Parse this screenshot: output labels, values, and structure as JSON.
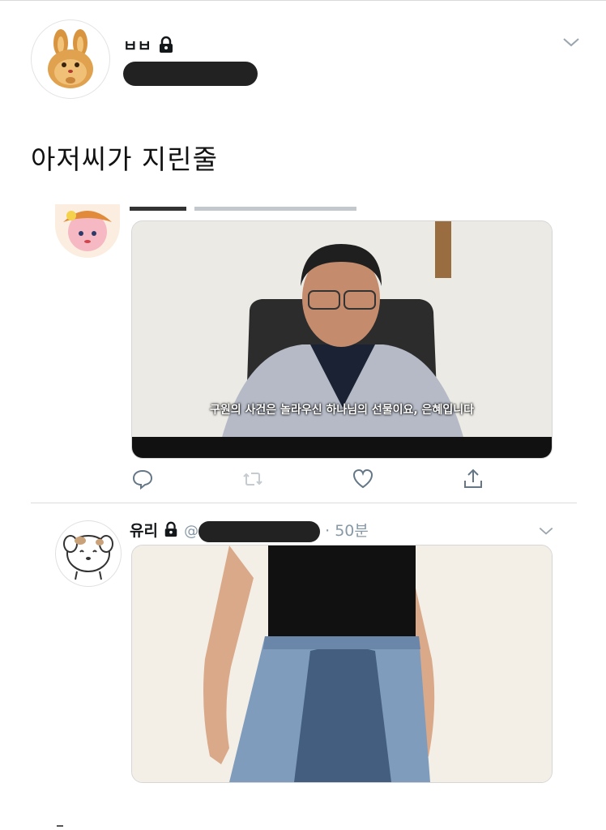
{
  "main_tweet": {
    "author_name": "ㅂㅂ",
    "handle_hidden": true,
    "text": "아저씨가 지린줄"
  },
  "quoted_tweet": {
    "media_caption": "구원의 사건은 놀라우신 하나님의 선물이요, 은혜입니다"
  },
  "actions": {
    "reply": "reply-icon",
    "retweet": "retweet-icon",
    "like": "heart-icon",
    "share": "share-icon"
  },
  "reply_tweet": {
    "author_name": "유리",
    "handle_prefix": "@",
    "handle_separator": "·",
    "time": "50분"
  },
  "colors": {
    "text": "#14171a",
    "muted": "#8899a6",
    "redaction": "#222222",
    "divider": "#dcdcdc"
  }
}
